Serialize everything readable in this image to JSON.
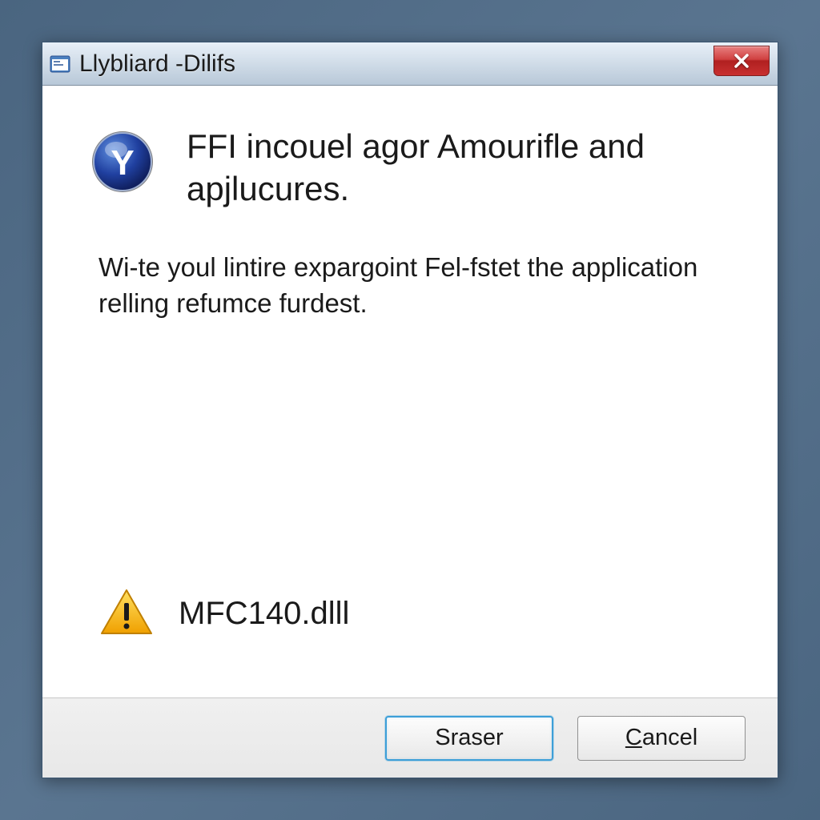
{
  "titlebar": {
    "title": "Llybliard -Dilifs"
  },
  "dialog": {
    "heading": "FFI incouel agor Amourifle and apjlucures.",
    "body": "Wi-te youl lintire expargoint Fel-fstet the application relling refumce furdest.",
    "warning_file": "MFC140.dlll"
  },
  "buttons": {
    "primary": "Sraser",
    "cancel_prefix": "C",
    "cancel_rest": "ancel"
  }
}
